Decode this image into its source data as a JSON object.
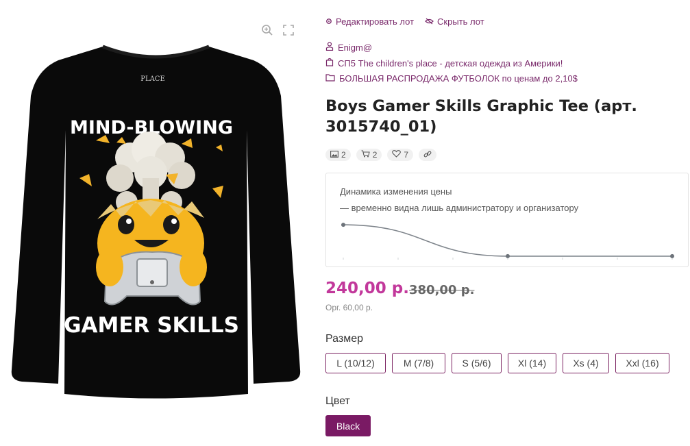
{
  "image": {
    "print_top": "MIND-BLOWING",
    "print_bottom": "GAMER SKILLS",
    "brand_tag": "PLACE",
    "tools": [
      {
        "icon": "zoom-in-icon"
      },
      {
        "icon": "fullscreen-icon"
      }
    ]
  },
  "actions": {
    "edit_label": "Редактировать лот",
    "hide_label": "Скрыть лот"
  },
  "meta": {
    "user": "Enigm@",
    "purchase": "СП5 The children's place - детская одежда из Америки!",
    "category": "БОЛЬШАЯ РАСПРОДАЖА ФУТБОЛОК по ценам до 2,10$"
  },
  "product": {
    "title": "Boys Gamer Skills Graphic Tee (арт. 3015740_01)"
  },
  "stats": {
    "photos": "2",
    "cart": "2",
    "likes": "7"
  },
  "price_history": {
    "title": "Динамика изменения цены",
    "note": "— временно видна лишь администратору и организатору"
  },
  "chart_data": {
    "type": "line",
    "title": "Динамика изменения цены",
    "series": [
      {
        "values": [
          380,
          240,
          240
        ]
      }
    ],
    "x_count": 3,
    "ylim": [
      200,
      420
    ],
    "grid": false,
    "line_color": "#7f858c"
  },
  "pricing": {
    "price": "240,00 р.",
    "old_price": "380,00 р.",
    "org_price": "Орг. 60,00 р."
  },
  "size": {
    "label": "Размер",
    "options": [
      "L (10/12)",
      "M (7/8)",
      "S (5/6)",
      "Xl (14)",
      "Xs (4)",
      "Xxl (16)"
    ]
  },
  "color": {
    "label": "Цвет",
    "selected": "Black"
  },
  "colors": {
    "accent": "#7a1a64",
    "link": "#7a2a6b",
    "price": "#c2389b"
  }
}
